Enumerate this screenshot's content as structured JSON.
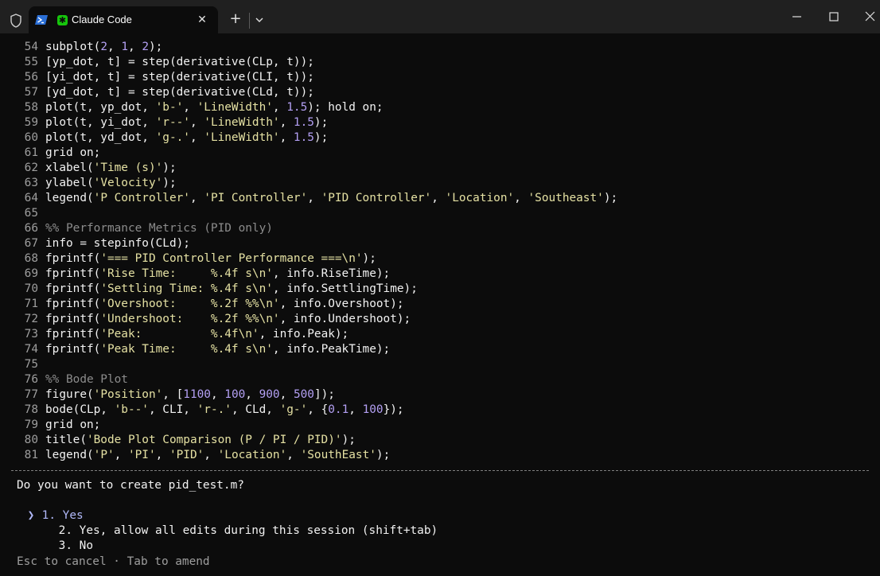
{
  "window": {
    "tab_title": "Claude Code",
    "icons": {
      "shield": "shield-icon",
      "powershell": "powershell-icon",
      "claude": "claude-icon",
      "close_tab": "close-icon",
      "new_tab": "plus-icon",
      "dropdown": "chevron-down-icon",
      "minimize": "minimize-icon",
      "maximize": "maximize-icon",
      "close_window": "close-icon"
    },
    "glyphs": {
      "close_tab": "✕",
      "new_tab": "+",
      "claude": "✱"
    }
  },
  "colors": {
    "string": "#e5e1a3",
    "number": "#b4a0f4",
    "comment": "#8c8c8c",
    "selected": "#b1b9f9",
    "line_number": "#9e9e9e"
  },
  "code_lines": [
    {
      "n": "54",
      "tokens": [
        [
          "id",
          "subplot("
        ],
        [
          "num",
          "2"
        ],
        [
          "id",
          ", "
        ],
        [
          "num",
          "1"
        ],
        [
          "id",
          ", "
        ],
        [
          "num",
          "2"
        ],
        [
          "id",
          ");"
        ]
      ]
    },
    {
      "n": "55",
      "tokens": [
        [
          "id",
          "[yp_dot, t] "
        ],
        [
          "op",
          "="
        ],
        [
          "id",
          " step(derivative(CLp, t));"
        ]
      ]
    },
    {
      "n": "56",
      "tokens": [
        [
          "id",
          "[yi_dot, t] "
        ],
        [
          "op",
          "="
        ],
        [
          "id",
          " step(derivative(CLI, t));"
        ]
      ]
    },
    {
      "n": "57",
      "tokens": [
        [
          "id",
          "[yd_dot, t] "
        ],
        [
          "op",
          "="
        ],
        [
          "id",
          " step(derivative(CLd, t));"
        ]
      ]
    },
    {
      "n": "58",
      "tokens": [
        [
          "id",
          "plot(t, yp_dot, "
        ],
        [
          "str",
          "'b-'"
        ],
        [
          "id",
          ", "
        ],
        [
          "str",
          "'LineWidth'"
        ],
        [
          "id",
          ", "
        ],
        [
          "num",
          "1.5"
        ],
        [
          "id",
          "); hold on;"
        ]
      ]
    },
    {
      "n": "59",
      "tokens": [
        [
          "id",
          "plot(t, yi_dot, "
        ],
        [
          "str",
          "'r--'"
        ],
        [
          "id",
          ", "
        ],
        [
          "str",
          "'LineWidth'"
        ],
        [
          "id",
          ", "
        ],
        [
          "num",
          "1.5"
        ],
        [
          "id",
          ");"
        ]
      ]
    },
    {
      "n": "60",
      "tokens": [
        [
          "id",
          "plot(t, yd_dot, "
        ],
        [
          "str",
          "'g-.'"
        ],
        [
          "id",
          ", "
        ],
        [
          "str",
          "'LineWidth'"
        ],
        [
          "id",
          ", "
        ],
        [
          "num",
          "1.5"
        ],
        [
          "id",
          ");"
        ]
      ]
    },
    {
      "n": "61",
      "tokens": [
        [
          "id",
          "grid on;"
        ]
      ]
    },
    {
      "n": "62",
      "tokens": [
        [
          "id",
          "xlabel("
        ],
        [
          "str",
          "'Time (s)'"
        ],
        [
          "id",
          ");"
        ]
      ]
    },
    {
      "n": "63",
      "tokens": [
        [
          "id",
          "ylabel("
        ],
        [
          "str",
          "'Velocity'"
        ],
        [
          "id",
          ");"
        ]
      ]
    },
    {
      "n": "64",
      "tokens": [
        [
          "id",
          "legend("
        ],
        [
          "str",
          "'P Controller'"
        ],
        [
          "id",
          ", "
        ],
        [
          "str",
          "'PI Controller'"
        ],
        [
          "id",
          ", "
        ],
        [
          "str",
          "'PID Controller'"
        ],
        [
          "id",
          ", "
        ],
        [
          "str",
          "'Location'"
        ],
        [
          "id",
          ", "
        ],
        [
          "str",
          "'Southeast'"
        ],
        [
          "id",
          ");"
        ]
      ]
    },
    {
      "n": "65",
      "tokens": []
    },
    {
      "n": "66",
      "tokens": [
        [
          "cmt",
          "%% Performance Metrics (PID only)"
        ]
      ]
    },
    {
      "n": "67",
      "tokens": [
        [
          "id",
          "info "
        ],
        [
          "op",
          "="
        ],
        [
          "id",
          " stepinfo(CLd);"
        ]
      ]
    },
    {
      "n": "68",
      "tokens": [
        [
          "id",
          "fprintf("
        ],
        [
          "str",
          "'=== PID Controller Performance ===\\n'"
        ],
        [
          "id",
          ");"
        ]
      ]
    },
    {
      "n": "69",
      "tokens": [
        [
          "id",
          "fprintf("
        ],
        [
          "str",
          "'Rise Time:     %.4f s\\n'"
        ],
        [
          "id",
          ", info.RiseTime);"
        ]
      ]
    },
    {
      "n": "70",
      "tokens": [
        [
          "id",
          "fprintf("
        ],
        [
          "str",
          "'Settling Time: %.4f s\\n'"
        ],
        [
          "id",
          ", info.SettlingTime);"
        ]
      ]
    },
    {
      "n": "71",
      "tokens": [
        [
          "id",
          "fprintf("
        ],
        [
          "str",
          "'Overshoot:     %.2f %%\\n'"
        ],
        [
          "id",
          ", info.Overshoot);"
        ]
      ]
    },
    {
      "n": "72",
      "tokens": [
        [
          "id",
          "fprintf("
        ],
        [
          "str",
          "'Undershoot:    %.2f %%\\n'"
        ],
        [
          "id",
          ", info.Undershoot);"
        ]
      ]
    },
    {
      "n": "73",
      "tokens": [
        [
          "id",
          "fprintf("
        ],
        [
          "str",
          "'Peak:          %.4f\\n'"
        ],
        [
          "id",
          ", info.Peak);"
        ]
      ]
    },
    {
      "n": "74",
      "tokens": [
        [
          "id",
          "fprintf("
        ],
        [
          "str",
          "'Peak Time:     %.4f s\\n'"
        ],
        [
          "id",
          ", info.PeakTime);"
        ]
      ]
    },
    {
      "n": "75",
      "tokens": []
    },
    {
      "n": "76",
      "tokens": [
        [
          "cmt",
          "%% Bode Plot"
        ]
      ]
    },
    {
      "n": "77",
      "tokens": [
        [
          "id",
          "figure("
        ],
        [
          "str",
          "'Position'"
        ],
        [
          "id",
          ", ["
        ],
        [
          "num",
          "1100"
        ],
        [
          "id",
          ", "
        ],
        [
          "num",
          "100"
        ],
        [
          "id",
          ", "
        ],
        [
          "num",
          "900"
        ],
        [
          "id",
          ", "
        ],
        [
          "num",
          "500"
        ],
        [
          "id",
          "]);"
        ]
      ]
    },
    {
      "n": "78",
      "tokens": [
        [
          "id",
          "bode(CLp, "
        ],
        [
          "str",
          "'b--'"
        ],
        [
          "id",
          ", CLI, "
        ],
        [
          "str",
          "'r-.'"
        ],
        [
          "id",
          ", CLd, "
        ],
        [
          "str",
          "'g-'"
        ],
        [
          "id",
          ", {"
        ],
        [
          "num",
          "0.1"
        ],
        [
          "id",
          ", "
        ],
        [
          "num",
          "100"
        ],
        [
          "id",
          "});"
        ]
      ]
    },
    {
      "n": "79",
      "tokens": [
        [
          "id",
          "grid on;"
        ]
      ]
    },
    {
      "n": "80",
      "tokens": [
        [
          "id",
          "title("
        ],
        [
          "str",
          "'Bode Plot Comparison (P / PI / PID)'"
        ],
        [
          "id",
          ");"
        ]
      ]
    },
    {
      "n": "81",
      "tokens": [
        [
          "id",
          "legend("
        ],
        [
          "str",
          "'P'"
        ],
        [
          "id",
          ", "
        ],
        [
          "str",
          "'PI'"
        ],
        [
          "id",
          ", "
        ],
        [
          "str",
          "'PID'"
        ],
        [
          "id",
          ", "
        ],
        [
          "str",
          "'Location'"
        ],
        [
          "id",
          ", "
        ],
        [
          "str",
          "'SouthEast'"
        ],
        [
          "id",
          ");"
        ]
      ]
    }
  ],
  "prompt": {
    "question": "Do you want to create pid_test.m?",
    "cursor": "❯",
    "options": [
      {
        "number": "1.",
        "label": "Yes",
        "selected": true
      },
      {
        "number": "2.",
        "label": "Yes, allow all edits during this session (shift+tab)",
        "selected": false
      },
      {
        "number": "3.",
        "label": "No",
        "selected": false
      }
    ],
    "hint": "Esc to cancel · Tab to amend"
  }
}
